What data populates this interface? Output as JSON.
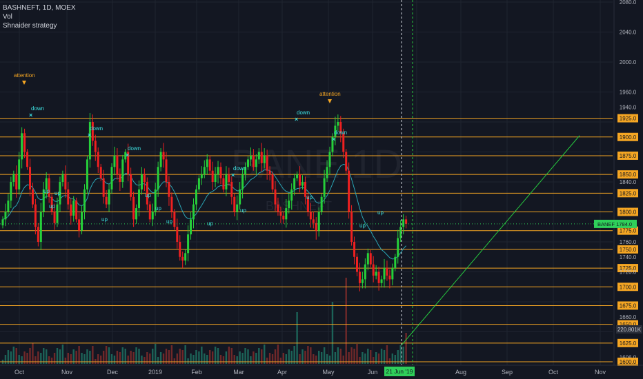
{
  "header": {
    "symbol_line": "BASHNEFT, 1D, MOEX",
    "indicator_1": "Vol",
    "indicator_2": "Shnaider strategy"
  },
  "watermark": {
    "symbol": "BANE 1D",
    "sub": "BASHNEFT"
  },
  "colors": {
    "background": "#131722",
    "grid": "#1f2430",
    "up": "#26d03a",
    "down": "#ef2020",
    "level_line": "#f5a623",
    "ma_line": "#2aa5b4",
    "price_tag": "#2fd05a",
    "projection": "#27c93f",
    "marker_cyan": "#3de0e0",
    "attention": "#f5a623"
  },
  "chart_data": {
    "type": "candlestick",
    "title": "BASHNEFT, 1D, MOEX",
    "ylim": [
      1600,
      2080
    ],
    "y_ticks": [
      2080,
      2040,
      2000,
      1960,
      1940,
      1925,
      1900,
      1875,
      1850,
      1840,
      1825,
      1800,
      1784,
      1775,
      1760,
      1750,
      1740,
      1725,
      1720,
      1700,
      1675,
      1660,
      1650,
      1625,
      1606,
      1600
    ],
    "x_labels": [
      "Oct",
      "Nov",
      "Dec",
      "2019",
      "Feb",
      "Mar",
      "Apr",
      "May",
      "Jun",
      "Aug",
      "Sep",
      "Oct",
      "Nov"
    ],
    "horizontal_levels": [
      {
        "value": 1925,
        "label": "1925.0"
      },
      {
        "value": 1900,
        "label": "1900.0"
      },
      {
        "value": 1875,
        "label": "1875.0"
      },
      {
        "value": 1850,
        "label": "1850.0"
      },
      {
        "value": 1825,
        "label": "1825.0"
      },
      {
        "value": 1800,
        "label": "1800.0"
      },
      {
        "value": 1775,
        "label": "1775.0"
      },
      {
        "value": 1750,
        "label": "1750.0"
      },
      {
        "value": 1725,
        "label": "1725.0"
      },
      {
        "value": 1700,
        "label": "1700.0"
      },
      {
        "value": 1675,
        "label": "1675.0"
      },
      {
        "value": 1650,
        "label": "1650.0"
      },
      {
        "value": 1625,
        "label": "1625.0"
      },
      {
        "value": 1600,
        "label": "1600.0"
      }
    ],
    "last_price": {
      "label": "BANEF",
      "value": "1784.0"
    },
    "volume_tag": "220.801K",
    "cursor_date": "21 Jun '19",
    "closes": [
      1790,
      1800,
      1815,
      1840,
      1850,
      1830,
      1870,
      1905,
      1880,
      1860,
      1830,
      1810,
      1780,
      1760,
      1800,
      1830,
      1845,
      1820,
      1800,
      1785,
      1810,
      1840,
      1850,
      1830,
      1810,
      1795,
      1815,
      1790,
      1775,
      1800,
      1830,
      1870,
      1920,
      1895,
      1880,
      1860,
      1845,
      1820,
      1810,
      1830,
      1860,
      1875,
      1850,
      1840,
      1870,
      1880,
      1850,
      1820,
      1790,
      1805,
      1830,
      1850,
      1840,
      1810,
      1790,
      1800,
      1830,
      1860,
      1880,
      1870,
      1840,
      1820,
      1800,
      1780,
      1760,
      1740,
      1735,
      1745,
      1770,
      1790,
      1810,
      1830,
      1845,
      1850,
      1860,
      1870,
      1855,
      1840,
      1850,
      1860,
      1845,
      1830,
      1850,
      1840,
      1820,
      1800,
      1810,
      1830,
      1850,
      1860,
      1870,
      1875,
      1860,
      1870,
      1880,
      1865,
      1875,
      1855,
      1850,
      1830,
      1810,
      1800,
      1795,
      1790,
      1805,
      1815,
      1830,
      1845,
      1850,
      1835,
      1840,
      1820,
      1800,
      1790,
      1785,
      1775,
      1800,
      1820,
      1845,
      1860,
      1880,
      1900,
      1915,
      1920,
      1905,
      1880,
      1855,
      1800,
      1760,
      1740,
      1720,
      1705,
      1710,
      1730,
      1745,
      1730,
      1715,
      1720,
      1705,
      1710,
      1725,
      1715,
      1710,
      1725,
      1740,
      1765,
      1780,
      1790,
      1784
    ],
    "markers_up": [
      [
        "up",
        63
      ],
      [
        "up",
        147
      ],
      [
        "up",
        71
      ],
      [
        "up",
        79
      ],
      [
        "up",
        241
      ],
      [
        "up",
        225
      ],
      [
        "up",
        210
      ],
      [
        "up",
        300
      ],
      [
        "up",
        348
      ],
      [
        "up",
        444
      ],
      [
        "up",
        521
      ],
      [
        "up",
        547
      ]
    ],
    "markers_down": [
      [
        "down",
        45
      ],
      [
        "down",
        130
      ],
      [
        "down",
        185
      ],
      [
        "down",
        338
      ],
      [
        "down",
        430
      ],
      [
        "down",
        484
      ]
    ],
    "annotations": [
      [
        "attention",
        35,
        112
      ],
      [
        "attention",
        478,
        139
      ]
    ]
  }
}
